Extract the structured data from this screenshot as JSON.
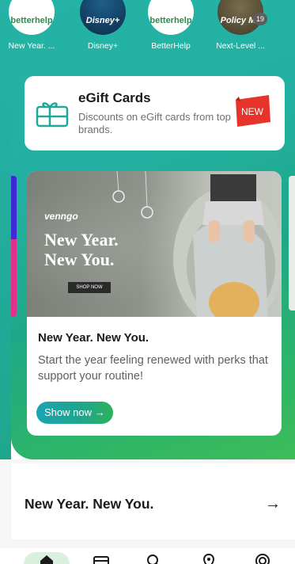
{
  "brands": [
    {
      "label": "New Year. ...",
      "logo_text": "betterhelp",
      "icon": "betterhelp-logo-icon"
    },
    {
      "label": "Disney+",
      "logo_text": "Disney+",
      "icon": "disney-plus-logo-icon"
    },
    {
      "label": "BetterHelp",
      "logo_text": "betterhelp",
      "icon": "betterhelp-logo-icon"
    },
    {
      "label": "Next-Level ...",
      "logo_text": "Policy Me",
      "icon": "policyme-logo-icon",
      "badge": "19"
    }
  ],
  "egift": {
    "title": "eGift Cards",
    "subtitle": "Discounts on eGift cards from top brands.",
    "flag": "NEW",
    "icon": "gift-card-icon",
    "accent": "#1fa79a",
    "flag_color": "#e8332a"
  },
  "promo": {
    "image_brand": "venngo",
    "image_headline": "New Year. New You.",
    "image_button": "SHOP NOW",
    "title": "New Year. New You.",
    "description": "Start the year feeling renewed with perks that support your routine!",
    "cta": "Show now →"
  },
  "section": {
    "title": "New Year. New You.",
    "arrow": "→"
  },
  "nav": {
    "items": [
      {
        "icon": "home-icon",
        "active": true
      },
      {
        "icon": "card-icon",
        "active": false
      },
      {
        "icon": "search-icon",
        "active": false
      },
      {
        "icon": "location-pin-icon",
        "active": false
      },
      {
        "icon": "target-icon",
        "active": false
      }
    ],
    "active_color": "#d9f0df"
  }
}
